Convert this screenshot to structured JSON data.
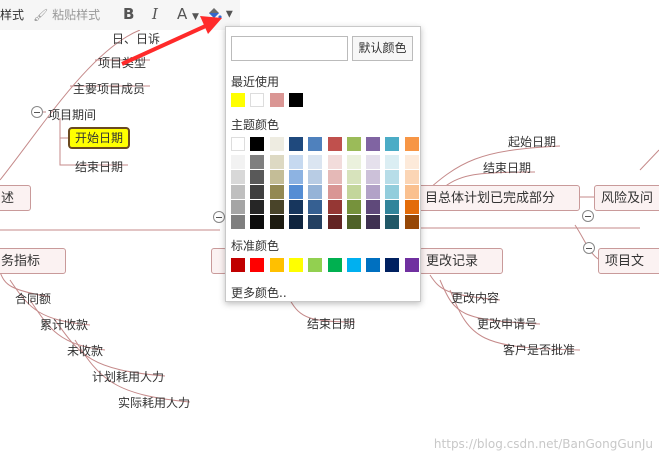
{
  "toolbar": {
    "style_label": "样式",
    "paste_style_label": "粘贴样式",
    "bold_label": "B",
    "italic_label": "I",
    "font_color_label": "A"
  },
  "mindmap": {
    "node_top_partial": "日、日诉",
    "project_type": "项目类型",
    "main_members": "主要项目成员",
    "project_period": "项目期间",
    "start_date_selected": "开始日期",
    "end_date": "结束日期",
    "left_box_partial": "述",
    "finance_partial": "务指标",
    "contract_amount": "合同额",
    "cumulative_received": "累计收款",
    "unreceived": "未收款",
    "planned_manpower": "计划耗用人力",
    "actual_manpower": "实际耗用人力",
    "start_date_right": "起始日期",
    "end_date_right": "结束日期",
    "plan_completed": "目总体计划已完成部分",
    "risk_partial": "风险及问",
    "change_record": "更改记录",
    "project_doc_partial": "项目文",
    "change_content": "更改内容",
    "change_request_no": "更改申请号",
    "customer_approve": "客户是否批准",
    "end_date_middle": "结束日期"
  },
  "color_picker": {
    "hex_value": "",
    "default_color_label": "默认颜色",
    "recent_label": "最近使用",
    "theme_label": "主题颜色",
    "standard_label": "标准颜色",
    "more_colors_label": "更多颜色..",
    "recent_colors": [
      "#ffff00",
      "#ffffff",
      "#da9694",
      "#000000"
    ],
    "theme_top": [
      "#ffffff",
      "#000000",
      "#eeece1",
      "#1f497d",
      "#4f81bd",
      "#c0504d",
      "#9bbb59",
      "#8064a2",
      "#4bacc6",
      "#f79646"
    ],
    "theme_shades": [
      [
        "#f2f2f2",
        "#7f7f7f",
        "#ddd9c3",
        "#c6d9f0",
        "#dbe5f1",
        "#f2dcdb",
        "#ebf1dd",
        "#e5e0ec",
        "#dbeef3",
        "#fdeada"
      ],
      [
        "#d8d8d8",
        "#595959",
        "#c4bd97",
        "#8db3e2",
        "#b8cce4",
        "#e5b9b7",
        "#d7e3bc",
        "#ccc1d9",
        "#b7dde8",
        "#fbd5b5"
      ],
      [
        "#bfbfbf",
        "#3f3f3f",
        "#938953",
        "#548dd4",
        "#95b3d7",
        "#d99694",
        "#c3d69b",
        "#b2a2c7",
        "#92cddc",
        "#fac08f"
      ],
      [
        "#a5a5a5",
        "#262626",
        "#494429",
        "#17365d",
        "#366092",
        "#953734",
        "#76923c",
        "#5f497a",
        "#31859b",
        "#e36c09"
      ],
      [
        "#7f7f7f",
        "#0c0c0c",
        "#1d1b10",
        "#0f243e",
        "#244061",
        "#632423",
        "#4f6128",
        "#3f3151",
        "#205867",
        "#974806"
      ]
    ],
    "standard_colors": [
      "#c00000",
      "#ff0000",
      "#ffc000",
      "#ffff00",
      "#92d050",
      "#00b050",
      "#00b0f0",
      "#0070c0",
      "#002060",
      "#7030a0"
    ]
  },
  "annotation": {
    "arrow_color": "#ff2a2a"
  },
  "watermark": "https://blog.csdn.net/BanGongGunJu"
}
